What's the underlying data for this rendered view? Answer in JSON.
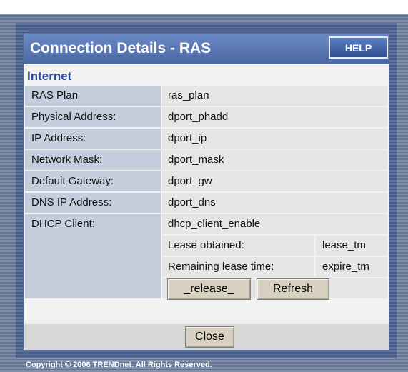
{
  "header": {
    "title": "Connection Details - RAS",
    "help_label": "HELP"
  },
  "section_title": "Internet",
  "rows": [
    {
      "label": "RAS Plan",
      "value": "ras_plan"
    },
    {
      "label": "Physical Address:",
      "value": "dport_phadd"
    },
    {
      "label": "IP Address:",
      "value": "dport_ip"
    },
    {
      "label": "Network Mask:",
      "value": "dport_mask"
    },
    {
      "label": "Default Gateway:",
      "value": "dport_gw"
    },
    {
      "label": "DNS IP Address:",
      "value": "dport_dns"
    }
  ],
  "dhcp": {
    "label": "DHCP Client:",
    "value": "dhcp_client_enable",
    "lease_obtained_label": "Lease obtained:",
    "lease_obtained_value": "lease_tm",
    "remaining_label": "Remaining lease time:",
    "remaining_value": "expire_tm",
    "release_label": "_release_",
    "refresh_label": "Refresh"
  },
  "footer": {
    "close_label": "Close",
    "copyright": "Copyright © 2006 TRENDnet. All Rights Reserved."
  }
}
